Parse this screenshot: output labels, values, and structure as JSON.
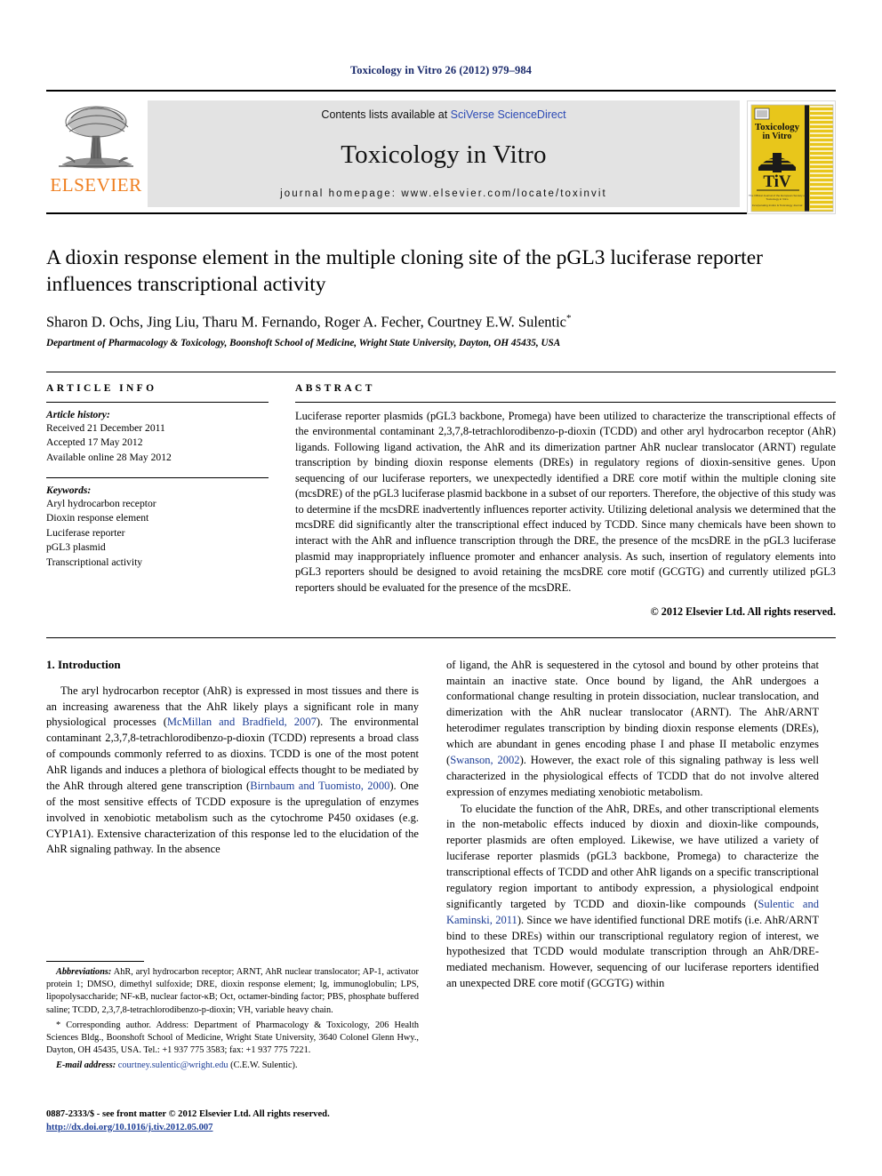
{
  "running_head": "Toxicology in Vitro 26 (2012) 979–984",
  "masthead": {
    "contents_prefix": "Contents lists available at ",
    "contents_link": "SciVerse ScienceDirect",
    "journal_name": "Toxicology in Vitro",
    "homepage": "journal homepage: www.elsevier.com/locate/toxinvit",
    "publisher": "ELSEVIER",
    "cover": {
      "title_line1": "Toxicology",
      "title_line2": "in Vitro",
      "logo_text": "TiV",
      "footer_line1": "The Official Journal of the European Society of Toxicology in Vitro",
      "footer_line2": "Incorporating Invitro & Toxicology Journal",
      "bg_color": "#e8c61b"
    }
  },
  "article": {
    "title": "A dioxin response element in the multiple cloning site of the pGL3 luciferase reporter influences transcriptional activity",
    "authors": "Sharon D. Ochs, Jing Liu, Tharu M. Fernando, Roger A. Fecher, Courtney E.W. Sulentic",
    "author_marker": "*",
    "affiliation": "Department of Pharmacology & Toxicology, Boonshoft School of Medicine, Wright State University, Dayton, OH 45435, USA"
  },
  "article_info": {
    "heading": "ARTICLE INFO",
    "history_label": "Article history:",
    "history": [
      "Received 21 December 2011",
      "Accepted 17 May 2012",
      "Available online 28 May 2012"
    ],
    "keywords_label": "Keywords:",
    "keywords": [
      "Aryl hydrocarbon receptor",
      "Dioxin response element",
      "Luciferase reporter",
      "pGL3 plasmid",
      "Transcriptional activity"
    ]
  },
  "abstract": {
    "heading": "ABSTRACT",
    "body": "Luciferase reporter plasmids (pGL3 backbone, Promega) have been utilized to characterize the transcriptional effects of the environmental contaminant 2,3,7,8-tetrachlorodibenzo-p-dioxin (TCDD) and other aryl hydrocarbon receptor (AhR) ligands. Following ligand activation, the AhR and its dimerization partner AhR nuclear translocator (ARNT) regulate transcription by binding dioxin response elements (DREs) in regulatory regions of dioxin-sensitive genes. Upon sequencing of our luciferase reporters, we unexpectedly identified a DRE core motif within the multiple cloning site (mcsDRE) of the pGL3 luciferase plasmid backbone in a subset of our reporters. Therefore, the objective of this study was to determine if the mcsDRE inadvertently influences reporter activity. Utilizing deletional analysis we determined that the mcsDRE did significantly alter the transcriptional effect induced by TCDD. Since many chemicals have been shown to interact with the AhR and influence transcription through the DRE, the presence of the mcsDRE in the pGL3 luciferase plasmid may inappropriately influence promoter and enhancer analysis. As such, insertion of regulatory elements into pGL3 reporters should be designed to avoid retaining the mcsDRE core motif (GCGTG) and currently utilized pGL3 reporters should be evaluated for the presence of the mcsDRE.",
    "copyright": "© 2012 Elsevier Ltd. All rights reserved."
  },
  "introduction": {
    "section_title": "1. Introduction",
    "left_paragraph_1a": "The aryl hydrocarbon receptor (AhR) is expressed in most tissues and there is an increasing awareness that the AhR likely plays a significant role in many physiological processes (",
    "left_cite_1": "McMillan and Bradfield, 2007",
    "left_paragraph_1b": "). The environmental contaminant 2,3,7,8-tetrachlorodibenzo-p-dioxin (TCDD) represents a broad class of compounds commonly referred to as dioxins. TCDD is one of the most potent AhR ligands and induces a plethora of biological effects thought to be mediated by the AhR through altered gene transcription (",
    "left_cite_2": "Birnbaum and Tuomisto, 2000",
    "left_paragraph_1c": "). One of the most sensitive effects of TCDD exposure is the upregulation of enzymes involved in xenobiotic metabolism such as the cytochrome P450 oxidases (e.g. CYP1A1). Extensive characterization of this response led to the elucidation of the AhR signaling pathway. In the absence",
    "right_paragraph_1a": "of ligand, the AhR is sequestered in the cytosol and bound by other proteins that maintain an inactive state. Once bound by ligand, the AhR undergoes a conformational change resulting in protein dissociation, nuclear translocation, and dimerization with the AhR nuclear translocator (ARNT). The AhR/ARNT heterodimer regulates transcription by binding dioxin response elements (DREs), which are abundant in genes encoding phase I and phase II metabolic enzymes (",
    "right_cite_1": "Swanson, 2002",
    "right_paragraph_1b": "). However, the exact role of this signaling pathway is less well characterized in the physiological effects of TCDD that do not involve altered expression of enzymes mediating xenobiotic metabolism.",
    "right_paragraph_2a": "To elucidate the function of the AhR, DREs, and other transcriptional elements in the non-metabolic effects induced by dioxin and dioxin-like compounds, reporter plasmids are often employed. Likewise, we have utilized a variety of luciferase reporter plasmids (pGL3 backbone, Promega) to characterize the transcriptional effects of TCDD and other AhR ligands on a specific transcriptional regulatory region important to antibody expression, a physiological endpoint significantly targeted by TCDD and dioxin-like compounds (",
    "right_cite_2": "Sulentic and Kaminski, 2011",
    "right_paragraph_2b": "). Since we have identified functional DRE motifs (i.e. AhR/ARNT bind to these DREs) within our transcriptional regulatory region of interest, we hypothesized that TCDD would modulate transcription through an AhR/DRE-mediated mechanism. However, sequencing of our luciferase reporters identified an unexpected DRE core motif (GCGTG) within"
  },
  "footnotes": {
    "abbrev_label": "Abbreviations:",
    "abbrev_text": " AhR, aryl hydrocarbon receptor; ARNT, AhR nuclear translocator; AP-1, activator protein 1; DMSO, dimethyl sulfoxide; DRE, dioxin response element; Ig, immunoglobulin; LPS, lipopolysaccharide; NF-κB, nuclear factor-κB; Oct, octamer-binding factor; PBS, phosphate buffered saline; TCDD, 2,3,7,8-tetrachlorodibenzo-p-dioxin; VH, variable heavy chain.",
    "corresponding": "* Corresponding author. Address: Department of Pharmacology & Toxicology, 206 Health Sciences Bldg., Boonshoft School of Medicine, Wright State University, 3640 Colonel Glenn Hwy., Dayton, OH 45435, USA. Tel.: +1 937 775 3583; fax: +1 937 775 7221.",
    "email_label": "E-mail address:",
    "email": "courtney.sulentic@wright.edu",
    "email_suffix": " (C.E.W. Sulentic)."
  },
  "page_footer": {
    "issn_line": "0887-2333/$ - see front matter © 2012 Elsevier Ltd. All rights reserved.",
    "doi": "http://dx.doi.org/10.1016/j.tiv.2012.05.007"
  }
}
